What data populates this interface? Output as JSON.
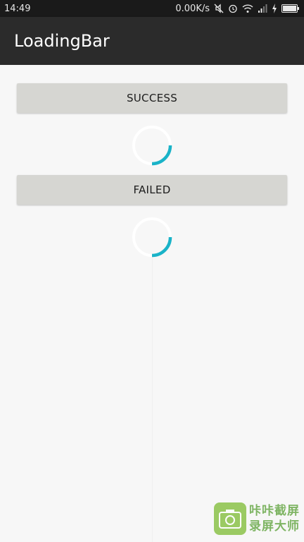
{
  "status_bar": {
    "time": "14:49",
    "network_speed": "0.00K/s",
    "icons": [
      "mute-icon",
      "alarm-icon",
      "wifi-icon",
      "signal-icon",
      "charging-icon",
      "battery-icon"
    ]
  },
  "app_bar": {
    "title": "LoadingBar"
  },
  "main": {
    "success_button_label": "SUCCESS",
    "failed_button_label": "FAILED",
    "loaders": [
      {
        "name": "loading-spinner-success",
        "arc_color": "#1ab3c8"
      },
      {
        "name": "loading-spinner-failed",
        "arc_color": "#1ab3c8"
      }
    ]
  },
  "watermark": {
    "line1": "咔咔截屏",
    "line2": "录屏大师",
    "icon": "camera-icon"
  },
  "colors": {
    "accent": "#1ab3c8",
    "app_bar": "#2b2b2b",
    "status_bar": "#1a1a1a",
    "button": "#d6d6d2",
    "background": "#f7f7f7"
  }
}
